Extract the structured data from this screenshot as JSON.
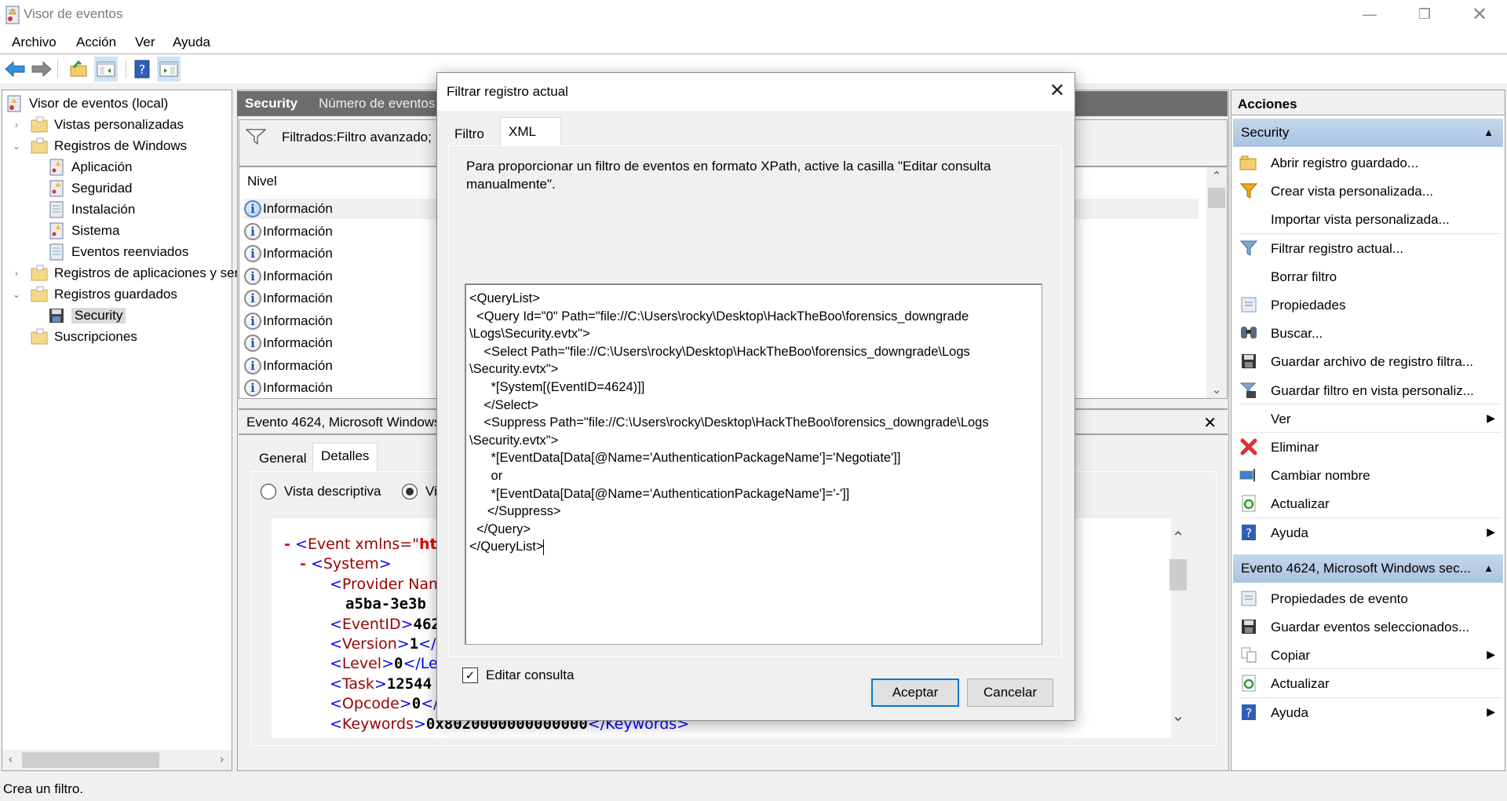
{
  "window": {
    "title": "Visor de eventos",
    "controls": [
      "minimize",
      "maximize",
      "close"
    ]
  },
  "menu": [
    "Archivo",
    "Acción",
    "Ver",
    "Ayuda"
  ],
  "toolbar": {
    "buttons": [
      "back-arrow-icon",
      "forward-arrow-icon",
      "open-folder-icon",
      "show-hide-console-tree-icon",
      "help-icon",
      "show-hide-action-pane-icon"
    ]
  },
  "tree": {
    "items": [
      {
        "label": "Visor de eventos (local)",
        "level": 0,
        "expander": ""
      },
      {
        "label": "Vistas personalizadas",
        "level": 1,
        "expander": "collapsed"
      },
      {
        "label": "Registros de Windows",
        "level": 1,
        "expander": "expanded"
      },
      {
        "label": "Aplicación",
        "level": 2,
        "expander": ""
      },
      {
        "label": "Seguridad",
        "level": 2,
        "expander": ""
      },
      {
        "label": "Instalación",
        "level": 2,
        "expander": ""
      },
      {
        "label": "Sistema",
        "level": 2,
        "expander": ""
      },
      {
        "label": "Eventos reenviados",
        "level": 2,
        "expander": ""
      },
      {
        "label": "Registros de aplicaciones y servicios",
        "level": 1,
        "expander": "collapsed"
      },
      {
        "label": "Registros guardados",
        "level": 1,
        "expander": "expanded"
      },
      {
        "label": "Security",
        "level": 2,
        "expander": "",
        "selected": true
      },
      {
        "label": "Suscripciones",
        "level": 1,
        "expander": ""
      }
    ]
  },
  "center": {
    "header_title": "Security",
    "header_sub": "Número de eventos",
    "filter_text": "Filtrados:Filtro avanzado;",
    "column_header": "Nivel",
    "events": [
      {
        "level": "Información",
        "selected": true
      },
      {
        "level": "Información"
      },
      {
        "level": "Información"
      },
      {
        "level": "Información"
      },
      {
        "level": "Información"
      },
      {
        "level": "Información"
      },
      {
        "level": "Información"
      },
      {
        "level": "Información"
      },
      {
        "level": "Información"
      }
    ],
    "detail": {
      "title": "Evento 4624, Microsoft Windows",
      "tabs": [
        {
          "label": "General"
        },
        {
          "label": "Detalles",
          "active": true
        }
      ],
      "radios": [
        {
          "label": "Vista descriptiva",
          "checked": false
        },
        {
          "label": "Vi",
          "checked": true
        }
      ],
      "xml_lines": [
        {
          "minus": "-",
          "open": "<",
          "name": "Event",
          "attr": " xmlns=\"",
          "attrval": "ht",
          "indent": 0
        },
        {
          "minus": "-",
          "open": "<",
          "name": "System",
          "close": ">",
          "indent": 1
        },
        {
          "open": "<",
          "name": "Provider Nam",
          "indent": 2
        },
        {
          "value": "a5ba-3e3b",
          "indent": 3
        },
        {
          "open": "<",
          "name": "EventID",
          "close": ">",
          "value": "462",
          "indent": 2
        },
        {
          "open": "<",
          "name": "Version",
          "close": ">",
          "value": "1",
          "endtag": "</",
          "indent": 2
        },
        {
          "open": "<",
          "name": "Level",
          "close": ">",
          "value": "0",
          "endtag": "</Le",
          "indent": 2
        },
        {
          "open": "<",
          "name": "Task",
          "close": ">",
          "value": "12544",
          "indent": 2
        },
        {
          "open": "<",
          "name": "Opcode",
          "close": ">",
          "value": "0",
          "endtag": "</",
          "indent": 2
        },
        {
          "open": "<",
          "name": "Keywords",
          "close": ">",
          "value": "0x8020000000000000",
          "endtag": "</Keywords>",
          "indent": 2
        }
      ]
    }
  },
  "actions": {
    "title": "Acciones",
    "sections": [
      {
        "title": "Security",
        "items": [
          {
            "label": "Abrir registro guardado...",
            "icon": "open-saved-log-icon"
          },
          {
            "label": "Crear vista personalizada...",
            "icon": "create-custom-view-icon"
          },
          {
            "label": "Importar vista personalizada...",
            "icon": ""
          },
          {
            "label": "Filtrar registro actual...",
            "icon": "filter-icon",
            "sep_before": true
          },
          {
            "label": "Borrar filtro",
            "icon": ""
          },
          {
            "label": "Propiedades",
            "icon": "properties-icon"
          },
          {
            "label": "Buscar...",
            "icon": "binoculars-icon"
          },
          {
            "label": "Guardar archivo de registro filtra...",
            "icon": "save-icon"
          },
          {
            "label": "Guardar filtro en vista personaliz...",
            "icon": "save-filter-icon"
          },
          {
            "label": "Ver",
            "icon": "",
            "submenu": true,
            "sep_before": true
          },
          {
            "label": "Eliminar",
            "icon": "delete-icon",
            "sep_before": true
          },
          {
            "label": "Cambiar nombre",
            "icon": "rename-icon"
          },
          {
            "label": "Actualizar",
            "icon": "refresh-icon"
          },
          {
            "label": "Ayuda",
            "icon": "help-icon",
            "submenu": true,
            "sep_before": true
          }
        ]
      },
      {
        "title": "Evento 4624, Microsoft Windows sec...",
        "items": [
          {
            "label": "Propiedades de evento",
            "icon": "event-properties-icon"
          },
          {
            "label": "Guardar eventos seleccionados...",
            "icon": "save-icon"
          },
          {
            "label": "Copiar",
            "icon": "copy-icon",
            "submenu": true
          },
          {
            "label": "Actualizar",
            "icon": "refresh-icon",
            "sep_before": true
          },
          {
            "label": "Ayuda",
            "icon": "help-icon",
            "submenu": true,
            "sep_before": true
          }
        ]
      }
    ]
  },
  "status": {
    "text": "Crea un filtro."
  },
  "dialog": {
    "title": "Filtrar registro actual",
    "tabs": [
      {
        "label": "Filtro"
      },
      {
        "label": "XML",
        "active": true
      }
    ],
    "description": "Para proporcionar un filtro de eventos en formato XPath, active la casilla \"Editar consulta manualmente\".",
    "query_text": "<QueryList>\n  <Query Id=\"0\" Path=\"file://C:\\Users\\rocky\\Desktop\\HackTheBoo\\forensics_downgrade\\Logs\\Security.evtx\">\n    <Select Path=\"file://C:\\Users\\rocky\\Desktop\\HackTheBoo\\forensics_downgrade\\Logs\\Security.evtx\">\n      *[System[(EventID=4624)]]\n    </Select>\n    <Suppress Path=\"file://C:\\Users\\rocky\\Desktop\\HackTheBoo\\forensics_downgrade\\Logs\\Security.evtx\">\n      *[EventData[Data[@Name='AuthenticationPackageName']='Negotiate']]\n      or\n      *[EventData[Data[@Name='AuthenticationPackageName']='-']]\n    </Suppress>\n  </Query>\n</QueryList>",
    "query_lines": [
      "<QueryList>",
      "  <Query Id=\"0\" Path=\"file://C:\\Users\\rocky\\Desktop\\HackTheBoo\\forensics_downgrade",
      "\\Logs\\Security.evtx\">",
      "    <Select Path=\"file://C:\\Users\\rocky\\Desktop\\HackTheBoo\\forensics_downgrade\\Logs",
      "\\Security.evtx\">",
      "      *[System[(EventID=4624)]]",
      "    </Select>",
      "    <Suppress Path=\"file://C:\\Users\\rocky\\Desktop\\HackTheBoo\\forensics_downgrade\\Logs",
      "\\Security.evtx\">",
      "      *[EventData[Data[@Name='AuthenticationPackageName']='Negotiate']]",
      "      or",
      "      *[EventData[Data[@Name='AuthenticationPackageName']='-']]",
      "     </Suppress>",
      "  </Query>",
      "</QueryList>"
    ],
    "edit_query_label": "Editar consulta",
    "edit_query_checked": true,
    "ok_label": "Aceptar",
    "cancel_label": "Cancelar"
  },
  "colors": {
    "accent": "#0078d7",
    "section_header": "#b5cce6",
    "center_header": "#6d6d6d",
    "xml_tag": "#0000ff",
    "xml_name": "#990000"
  }
}
